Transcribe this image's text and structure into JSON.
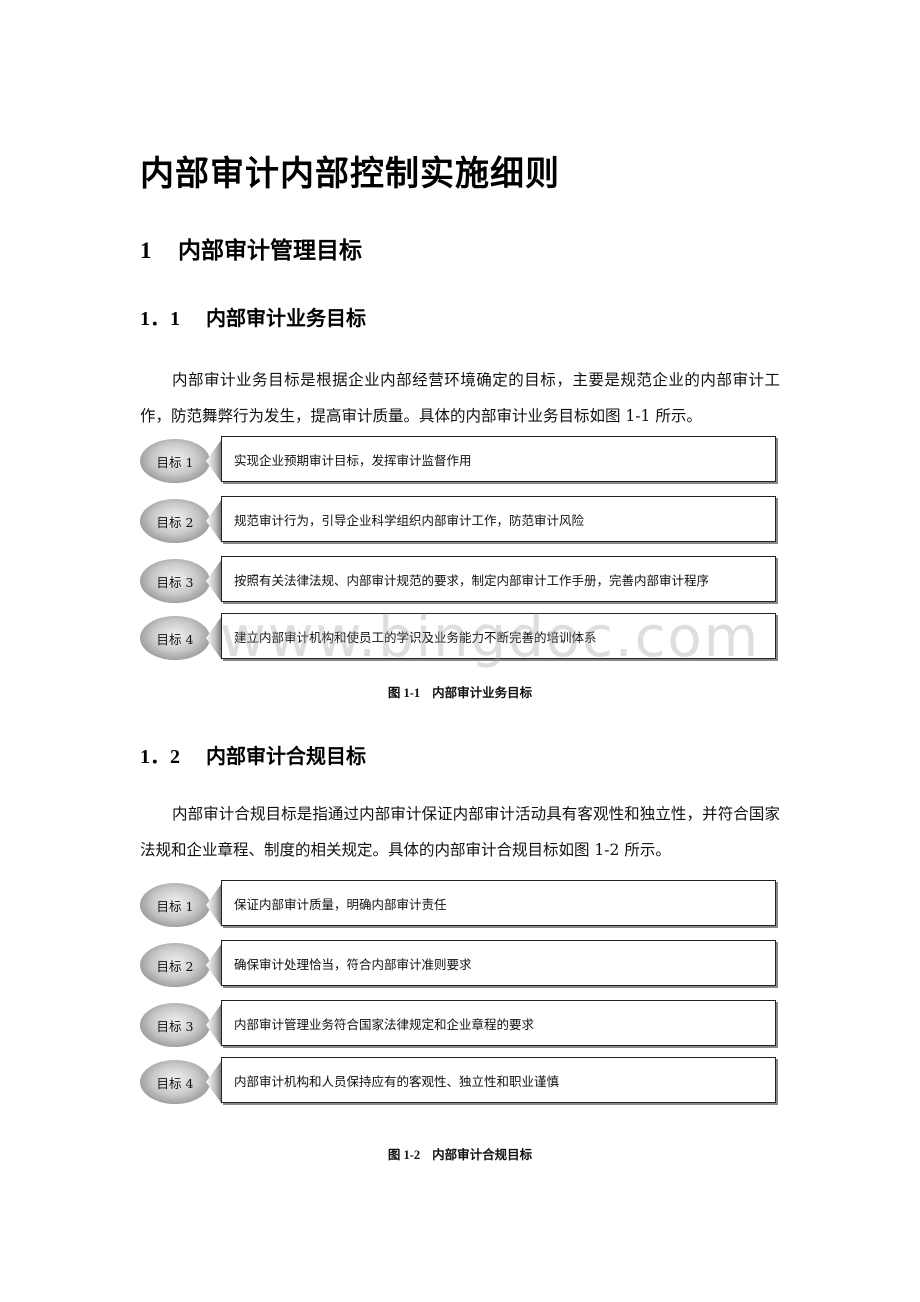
{
  "document": {
    "title": "内部审计内部控制实施细则",
    "section1": {
      "number": "1",
      "title": "内部审计管理目标"
    },
    "section1_1": {
      "number": "1．1",
      "title": "内部审计业务目标",
      "paragraph": "内部审计业务目标是根据企业内部经营环境确定的目标，主要是规范企业的内部审计工作，防范舞弊行为发生，提高审计质量。具体的内部审计业务目标如图 1-1 所示。",
      "figure": {
        "number": "图 1-1",
        "caption": "内部审计业务目标",
        "goals": [
          {
            "label": "目标 1",
            "text": "实现企业预期审计目标，发挥审计监督作用"
          },
          {
            "label": "目标 2",
            "text": "规范审计行为，引导企业科学组织内部审计工作，防范审计风险"
          },
          {
            "label": "目标 3",
            "text": "按照有关法律法规、内部审计规范的要求，制定内部审计工作手册，完善内部审计程序"
          },
          {
            "label": "目标 4",
            "text": "建立内部审计机构和使员工的学识及业务能力不断完善的培训体系"
          }
        ]
      }
    },
    "section1_2": {
      "number": "1．2",
      "title": "内部审计合规目标",
      "paragraph": "内部审计合规目标是指通过内部审计保证内部审计活动具有客观性和独立性，并符合国家法规和企业章程、制度的相关规定。具体的内部审计合规目标如图 1-2 所示。",
      "figure": {
        "number": "图 1-2",
        "caption": "内部审计合规目标",
        "goals": [
          {
            "label": "目标 1",
            "text": "保证内部审计质量，明确内部审计责任"
          },
          {
            "label": "目标 2",
            "text": "确保审计处理恰当，符合内部审计准则要求"
          },
          {
            "label": "目标 3",
            "text": "内部审计管理业务符合国家法律规定和企业章程的要求"
          },
          {
            "label": "目标 4",
            "text": "内部审计机构和人员保持应有的客观性、独立性和职业谨慎"
          }
        ]
      }
    },
    "watermark": "www.bingdoc.com"
  }
}
